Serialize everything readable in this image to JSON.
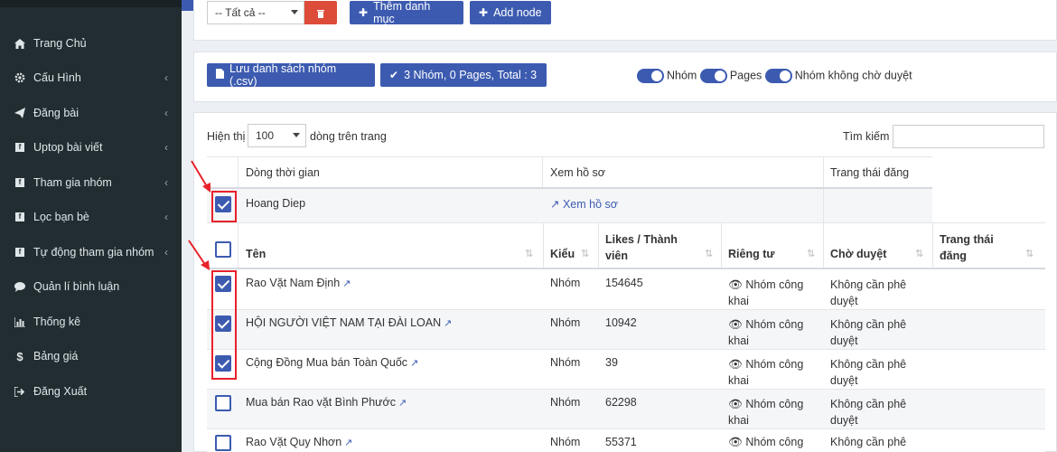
{
  "sidebar": {
    "items": [
      {
        "label": "Trang Chủ",
        "icon": "home-icon",
        "chevron": false
      },
      {
        "label": "Cấu Hình",
        "icon": "gear-icon",
        "chevron": true
      },
      {
        "label": "Đăng bài",
        "icon": "paper-plane-icon",
        "chevron": true
      },
      {
        "label": "Uptop bài viết",
        "icon": "facebook-square-icon",
        "chevron": true
      },
      {
        "label": "Tham gia nhóm",
        "icon": "facebook-square-icon",
        "chevron": true
      },
      {
        "label": "Lọc bạn bè",
        "icon": "facebook-square-icon",
        "chevron": true
      },
      {
        "label": "Tự động tham gia nhóm",
        "icon": "facebook-square-icon",
        "chevron": true
      },
      {
        "label": "Quản lí bình luận",
        "icon": "comment-icon",
        "chevron": false
      },
      {
        "label": "Thống kê",
        "icon": "bar-chart-icon",
        "chevron": false
      },
      {
        "label": "Bảng giá",
        "icon": "dollar-icon",
        "chevron": false
      },
      {
        "label": "Đăng Xuất",
        "icon": "sign-out-icon",
        "chevron": false
      }
    ]
  },
  "toolbar": {
    "filter_value": "-- Tất cả --",
    "add_category_label": "Thêm danh mục",
    "add_node_label": "Add node"
  },
  "actions": {
    "save_csv_label": "Lưu danh sách nhóm (.csv)",
    "summary_label": "3 Nhóm, 0 Pages, Total : 3",
    "toggle_groups": "Nhóm",
    "toggle_pages": "Pages",
    "toggle_unapproved": "Nhóm không chờ duyệt"
  },
  "table_controls": {
    "show_label": "Hiện thị",
    "page_size": "100",
    "per_page_label": "dòng trên trang",
    "search_label": "Tìm kiếm",
    "search_value": ""
  },
  "timeline": {
    "headers": [
      "Dòng thời gian",
      "Xem hồ sơ",
      "Trang thái đăng"
    ],
    "row": {
      "name": "Hoang Diep",
      "profile_link": "Xem hồ sơ",
      "checked": true
    }
  },
  "groups_table": {
    "headers": [
      "Tên",
      "Kiểu",
      "Likes / Thành viên",
      "Riêng tư",
      "Chờ duyệt",
      "Trang thái đăng"
    ],
    "rows": [
      {
        "name": "Rao Vặt Nam Định",
        "type": "Nhóm",
        "members": "154645",
        "privacy_line1": "Nhóm công",
        "privacy_line2": "khai",
        "approval_line1": "Không cần phê",
        "approval_line2": "duyệt",
        "checked": true
      },
      {
        "name": "HỘI NGƯỜI VIỆT NAM TẠI ĐÀI LOAN",
        "type": "Nhóm",
        "members": "10942",
        "privacy_line1": "Nhóm công",
        "privacy_line2": "khai",
        "approval_line1": "Không cần phê",
        "approval_line2": "duyệt",
        "checked": true
      },
      {
        "name": "Cộng Đồng Mua bán Toàn Quốc",
        "type": "Nhóm",
        "members": "39",
        "privacy_line1": "Nhóm công",
        "privacy_line2": "khai",
        "approval_line1": "Không cần phê",
        "approval_line2": "duyệt",
        "checked": true
      },
      {
        "name": "Mua bán Rao vặt Bình Phước",
        "type": "Nhóm",
        "members": "62298",
        "privacy_line1": "Nhóm công",
        "privacy_line2": "khai",
        "approval_line1": "Không cần phê",
        "approval_line2": "duyệt",
        "checked": false
      },
      {
        "name": "Rao Vặt Quy Nhơn",
        "type": "Nhóm",
        "members": "55371",
        "privacy_line1": "Nhóm công",
        "privacy_line2": "",
        "approval_line1": "Không cần phê",
        "approval_line2": "",
        "checked": false
      }
    ]
  },
  "colors": {
    "accent": "#3c5bb0",
    "sidebar": "#222d32",
    "highlight": "#e8212b",
    "danger": "#dd4b39"
  }
}
